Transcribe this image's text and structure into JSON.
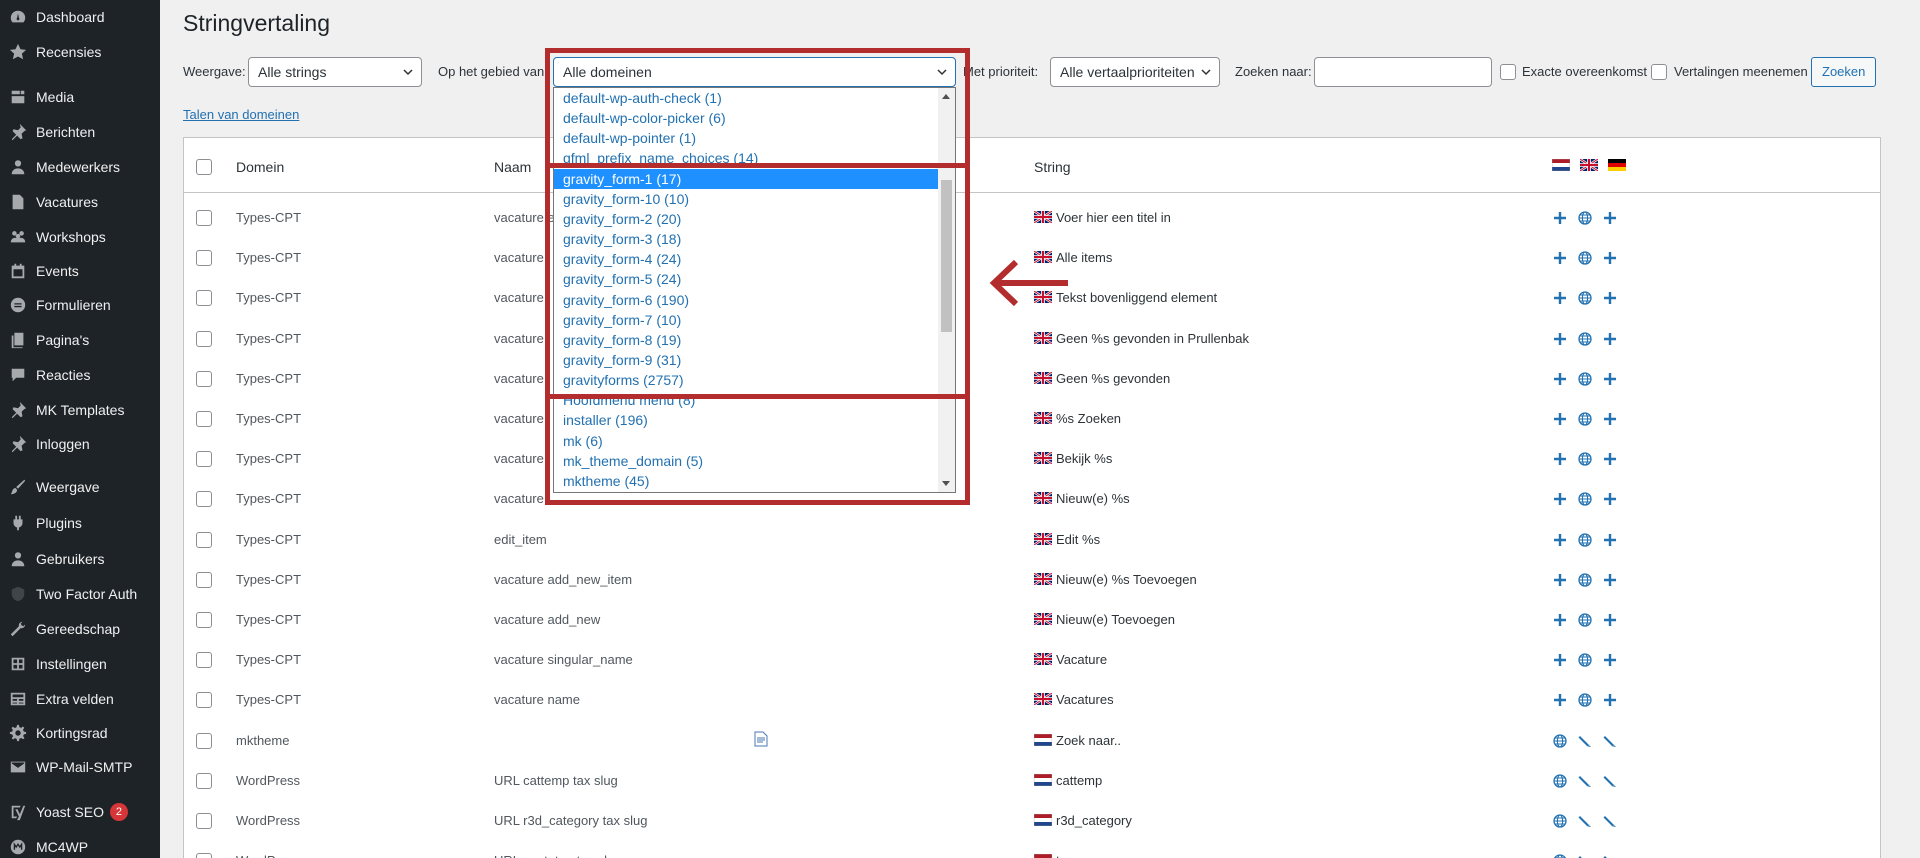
{
  "sidebar": {
    "items": [
      {
        "label": "Dashboard",
        "icon": "dashboard-icon"
      },
      {
        "label": "Recensies",
        "icon": "star-icon"
      },
      {
        "label": "Media",
        "icon": "media-icon"
      },
      {
        "label": "Berichten",
        "icon": "pin-icon"
      },
      {
        "label": "Medewerkers",
        "icon": "users-icon"
      },
      {
        "label": "Vacatures",
        "icon": "document-icon"
      },
      {
        "label": "Workshops",
        "icon": "group-icon"
      },
      {
        "label": "Events",
        "icon": "calendar-icon"
      },
      {
        "label": "Formulieren",
        "icon": "forms-icon"
      },
      {
        "label": "Pagina's",
        "icon": "pages-icon"
      },
      {
        "label": "Reacties",
        "icon": "comment-icon"
      },
      {
        "label": "MK Templates",
        "icon": "pin-icon"
      },
      {
        "label": "Inloggen",
        "icon": "pin-icon"
      },
      {
        "label": "Weergave",
        "icon": "brush-icon"
      },
      {
        "label": "Plugins",
        "icon": "plugin-icon"
      },
      {
        "label": "Gebruikers",
        "icon": "user-icon"
      },
      {
        "label": "Two Factor Auth",
        "icon": "shield-icon"
      },
      {
        "label": "Gereedschap",
        "icon": "wrench-icon"
      },
      {
        "label": "Instellingen",
        "icon": "settings-icon"
      },
      {
        "label": "Extra velden",
        "icon": "table-icon"
      },
      {
        "label": "Kortingsrad",
        "icon": "gear-icon"
      },
      {
        "label": "WP-Mail-SMTP",
        "icon": "mail-icon"
      },
      {
        "label": "Yoast SEO",
        "icon": "yoast-icon",
        "badge": "2"
      },
      {
        "label": "MC4WP",
        "icon": "mc4wp-icon"
      }
    ]
  },
  "page": {
    "title": "Stringvertaling"
  },
  "filters": {
    "view_label": "Weergave:",
    "view_value": "Alle strings",
    "domain_label": "Op het gebied van",
    "domain_value": "Alle domeinen",
    "priority_label": "Met prioriteit:",
    "priority_value": "Alle vertaalprioriteiten",
    "search_label": "Zoeken naar:",
    "search_value": "",
    "exact_label": "Exacte overeenkomst",
    "include_label": "Vertalingen meenemen",
    "search_button": "Zoeken",
    "domain_languages_link": "Talen van domeinen"
  },
  "dropdown": {
    "options": [
      "default-wp-auth-check (1)",
      "default-wp-color-picker (6)",
      "default-wp-pointer (1)",
      "gfml_prefix_name_choices (14)",
      "gravity_form-1 (17)",
      "gravity_form-10 (10)",
      "gravity_form-2 (20)",
      "gravity_form-3 (18)",
      "gravity_form-4 (24)",
      "gravity_form-5 (24)",
      "gravity_form-6 (190)",
      "gravity_form-7 (10)",
      "gravity_form-8 (19)",
      "gravity_form-9 (31)",
      "gravityforms (2757)",
      "Hoofdmenu menu (8)",
      "installer (196)",
      "mk (6)",
      "mk_theme_domain (5)",
      "mktheme (45)"
    ],
    "selected_index": 4
  },
  "table": {
    "columns": {
      "domain": "Domein",
      "name": "Naam",
      "string": "String"
    },
    "rows": [
      {
        "domain": "Types-CPT",
        "name": "vacature e",
        "lang": "en",
        "string": "Voer hier een titel in",
        "actions": [
          "plus",
          "globe",
          "plus"
        ]
      },
      {
        "domain": "Types-CPT",
        "name": "vacature",
        "lang": "en",
        "string": "Alle items",
        "actions": [
          "plus",
          "globe",
          "plus"
        ]
      },
      {
        "domain": "Types-CPT",
        "name": "vacature",
        "lang": "en",
        "string": "Tekst bovenliggend element",
        "actions": [
          "plus",
          "globe",
          "plus"
        ]
      },
      {
        "domain": "Types-CPT",
        "name": "vacature",
        "lang": "en",
        "string": "Geen %s gevonden in Prullenbak",
        "actions": [
          "plus",
          "globe",
          "plus"
        ]
      },
      {
        "domain": "Types-CPT",
        "name": "vacature",
        "lang": "en",
        "string": "Geen %s gevonden",
        "actions": [
          "plus",
          "globe",
          "plus"
        ]
      },
      {
        "domain": "Types-CPT",
        "name": "vacature",
        "lang": "en",
        "string": "%s Zoeken",
        "actions": [
          "plus",
          "globe",
          "plus"
        ]
      },
      {
        "domain": "Types-CPT",
        "name": "vacature",
        "lang": "en",
        "string": "Bekijk %s",
        "actions": [
          "plus",
          "globe",
          "plus"
        ]
      },
      {
        "domain": "Types-CPT",
        "name": "vacature",
        "lang": "en",
        "string": "Nieuw(e) %s",
        "actions": [
          "plus",
          "globe",
          "plus"
        ]
      },
      {
        "domain": "Types-CPT",
        "name": "edit_item",
        "lang": "en",
        "string": "Edit %s",
        "actions": [
          "plus",
          "globe",
          "plus"
        ]
      },
      {
        "domain": "Types-CPT",
        "name": "vacature add_new_item",
        "lang": "en",
        "string": "Nieuw(e) %s Toevoegen",
        "actions": [
          "plus",
          "globe",
          "plus"
        ]
      },
      {
        "domain": "Types-CPT",
        "name": "vacature add_new",
        "lang": "en",
        "string": "Nieuw(e) Toevoegen",
        "actions": [
          "plus",
          "globe",
          "plus"
        ]
      },
      {
        "domain": "Types-CPT",
        "name": "vacature singular_name",
        "lang": "en",
        "string": "Vacature",
        "actions": [
          "plus",
          "globe",
          "plus"
        ]
      },
      {
        "domain": "Types-CPT",
        "name": "vacature name",
        "lang": "en",
        "string": "Vacatures",
        "actions": [
          "plus",
          "globe",
          "plus"
        ]
      },
      {
        "domain": "mktheme",
        "name": "",
        "lang": "nl",
        "string": "Zoek naar..",
        "actions": [
          "globe",
          "pencil",
          "pencil"
        ],
        "name_icon": "document-icon"
      },
      {
        "domain": "WordPress",
        "name": "URL cattemp tax slug",
        "lang": "nl",
        "string": "cattemp",
        "actions": [
          "globe",
          "pencil",
          "pencil"
        ]
      },
      {
        "domain": "WordPress",
        "name": "URL r3d_category tax slug",
        "lang": "nl",
        "string": "r3d_category",
        "actions": [
          "globe",
          "pencil",
          "pencil"
        ]
      },
      {
        "domain": "WordPress",
        "name": "URL post_tag tax slug",
        "lang": "nl",
        "string": "tag",
        "actions": [
          "globe",
          "pencil",
          "pencil"
        ]
      }
    ]
  },
  "colors": {
    "accent": "#2271b1",
    "annotation": "#b32d2e",
    "selected": "#1e90ff",
    "sidebar": "#1d2327"
  }
}
